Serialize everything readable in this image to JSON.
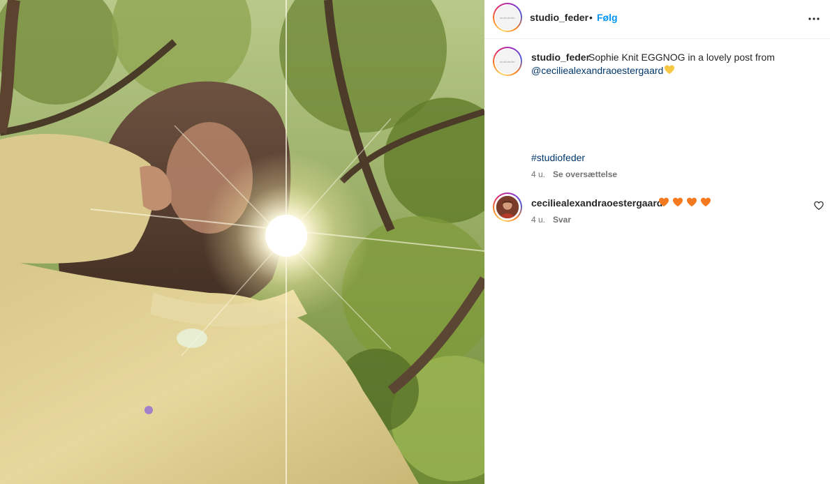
{
  "post": {
    "author": "studio_feder",
    "separator": "•",
    "follow_label": "Følg",
    "avatar_logo": "studiofeder",
    "more_icon": "more-horizontal-icon"
  },
  "caption": {
    "author": "studio_feder",
    "text": "Sophie Knit EGGNOG in a lovely post from",
    "mention": "@ceciliealexandraoestergaard",
    "emoji": "yellow-heart",
    "hashtag": "#studiofeder",
    "time": "4 u.",
    "translate_label": "Se oversættelse"
  },
  "comments": [
    {
      "author": "ceciliealexandraoestergaard",
      "emojis": [
        "orange-heart",
        "orange-heart",
        "orange-heart",
        "orange-heart"
      ],
      "time": "4 u.",
      "reply_label": "Svar",
      "like_icon": "heart-outline-icon"
    }
  ],
  "colors": {
    "link": "#00376b",
    "follow": "#0095f6",
    "muted": "#737373",
    "orange_heart": "#f4791f",
    "yellow_heart": "#f7c844"
  }
}
